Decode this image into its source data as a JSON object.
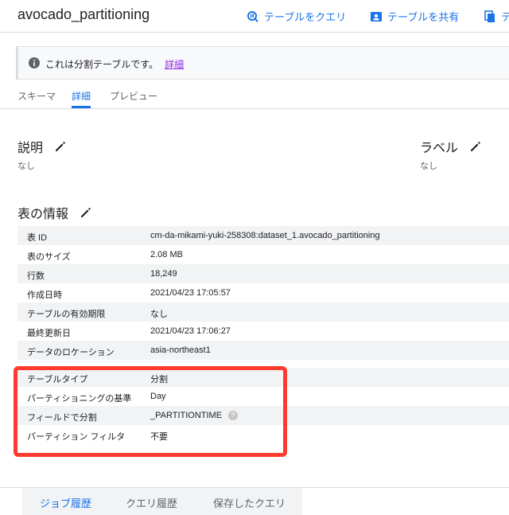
{
  "header": {
    "title": "avocado_partitioning",
    "actions": [
      {
        "label": "テーブルをクエリ",
        "icon": "query-icon"
      },
      {
        "label": "テーブルを共有",
        "icon": "share-icon"
      },
      {
        "label": "テ",
        "icon": "copy-icon"
      }
    ]
  },
  "notice": {
    "text": "これは分割テーブルです。",
    "link": "詳細",
    "icon": "info-icon"
  },
  "tabs": [
    "スキーマ",
    "詳細",
    "プレビュー"
  ],
  "active_tab": "詳細",
  "description": {
    "title": "説明",
    "value": "なし"
  },
  "labels": {
    "title": "ラベル",
    "value": "なし"
  },
  "table_info": {
    "title": "表の情報",
    "rows": [
      {
        "k": "表 ID",
        "v": "cm-da-mikami-yuki-258308:dataset_1.avocado_partitioning"
      },
      {
        "k": "表のサイズ",
        "v": "2.08 MB"
      },
      {
        "k": "行数",
        "v": "18,249"
      },
      {
        "k": "作成日時",
        "v": "2021/04/23 17:05:57"
      },
      {
        "k": "テーブルの有効期限",
        "v": "なし"
      },
      {
        "k": "最終更新日",
        "v": "2021/04/23 17:06:27"
      },
      {
        "k": "データのロケーション",
        "v": "asia-northeast1"
      }
    ],
    "partition_rows": [
      {
        "k": "テーブルタイプ",
        "v": "分割"
      },
      {
        "k": "パーティショニングの基準",
        "v": "Day"
      },
      {
        "k": "フィールドで分割",
        "v": "_PARTITIONTIME"
      },
      {
        "k": "パーティション フィルタ",
        "v": "不要"
      }
    ]
  },
  "bottom_tabs": [
    "ジョブ履歴",
    "クエリ履歴",
    "保存したクエリ"
  ],
  "colors": {
    "accent": "#1a73e8",
    "highlight": "#ff3b2f"
  }
}
